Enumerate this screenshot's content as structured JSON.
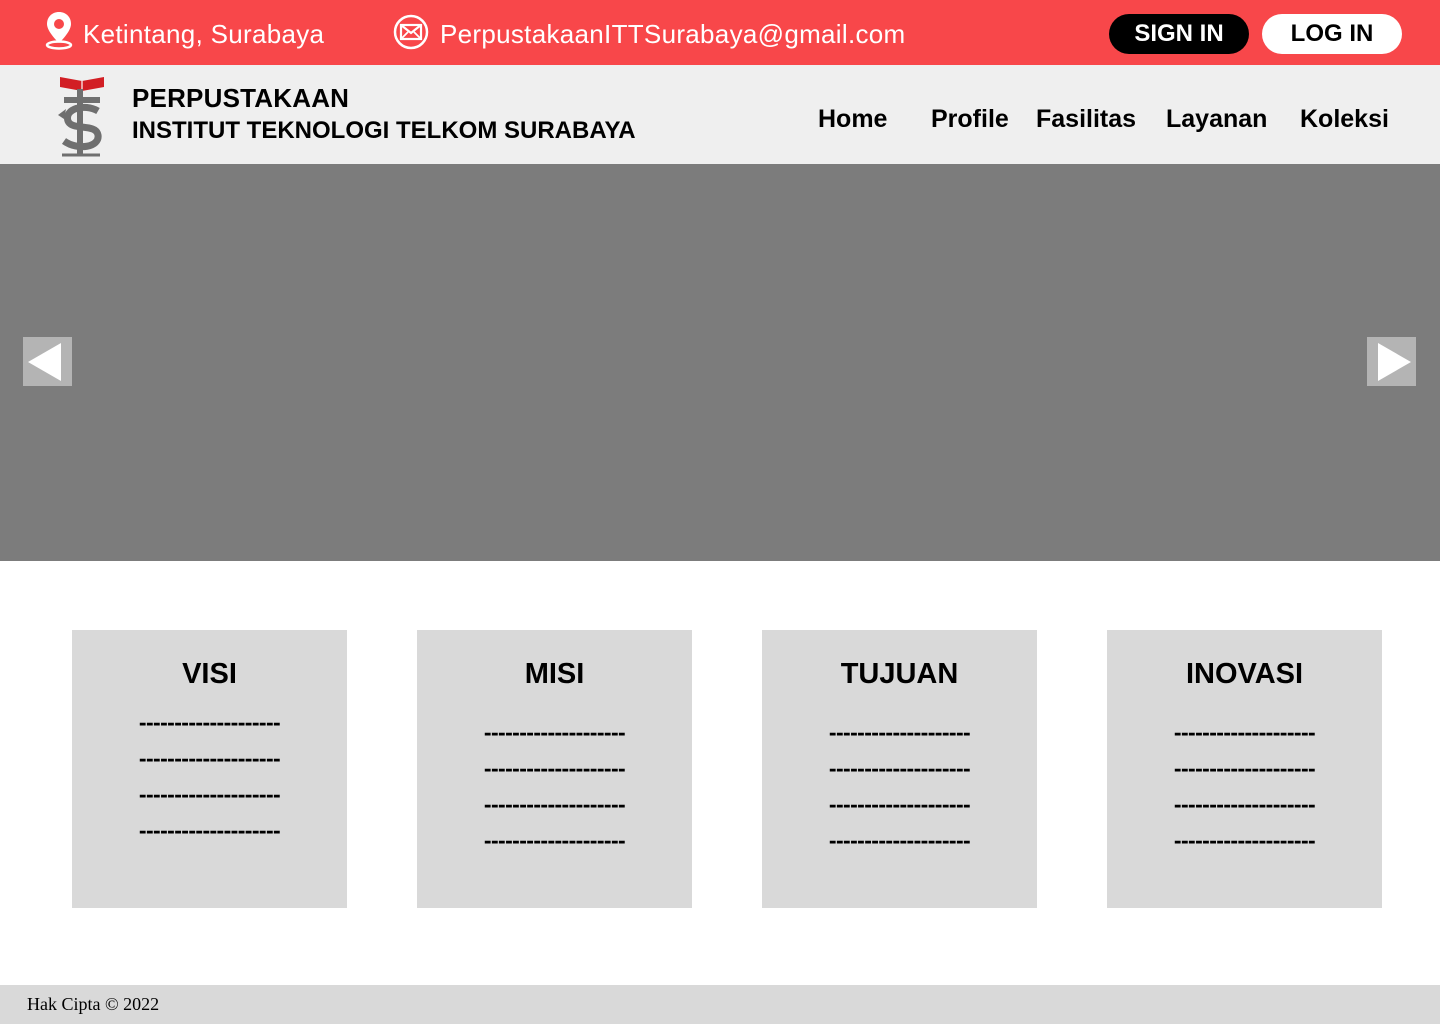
{
  "topbar": {
    "location": "Ketintang, Surabaya",
    "email": "PerpustakaanITTSurabaya@gmail.com",
    "sign_in_label": "SIGN IN",
    "log_in_label": "LOG IN",
    "background_color": "#f8474a"
  },
  "header": {
    "brand_line_1": "PERPUSTAKAAN",
    "brand_line_2": "INSTITUT TEKNOLOGI TELKOM SURABAYA",
    "nav": [
      {
        "label": "Home"
      },
      {
        "label": "Profile"
      },
      {
        "label": "Fasilitas"
      },
      {
        "label": "Layanan"
      },
      {
        "label": "Koleksi"
      }
    ]
  },
  "hero": {
    "prev_icon": "chevron-left-icon",
    "next_icon": "chevron-right-icon"
  },
  "cards": [
    {
      "title": "VISI",
      "lines": [
        "--------------------",
        "--------------------",
        "--------------------",
        "--------------------"
      ]
    },
    {
      "title": "MISI",
      "lines": [
        "--------------------",
        "--------------------",
        "--------------------",
        "--------------------"
      ]
    },
    {
      "title": "TUJUAN",
      "lines": [
        "--------------------",
        "--------------------",
        "--------------------",
        "--------------------"
      ]
    },
    {
      "title": "INOVASI",
      "lines": [
        "--------------------",
        "--------------------",
        "--------------------",
        "--------------------"
      ]
    }
  ],
  "footer": {
    "copyright": "Hak Cipta © 2022"
  }
}
